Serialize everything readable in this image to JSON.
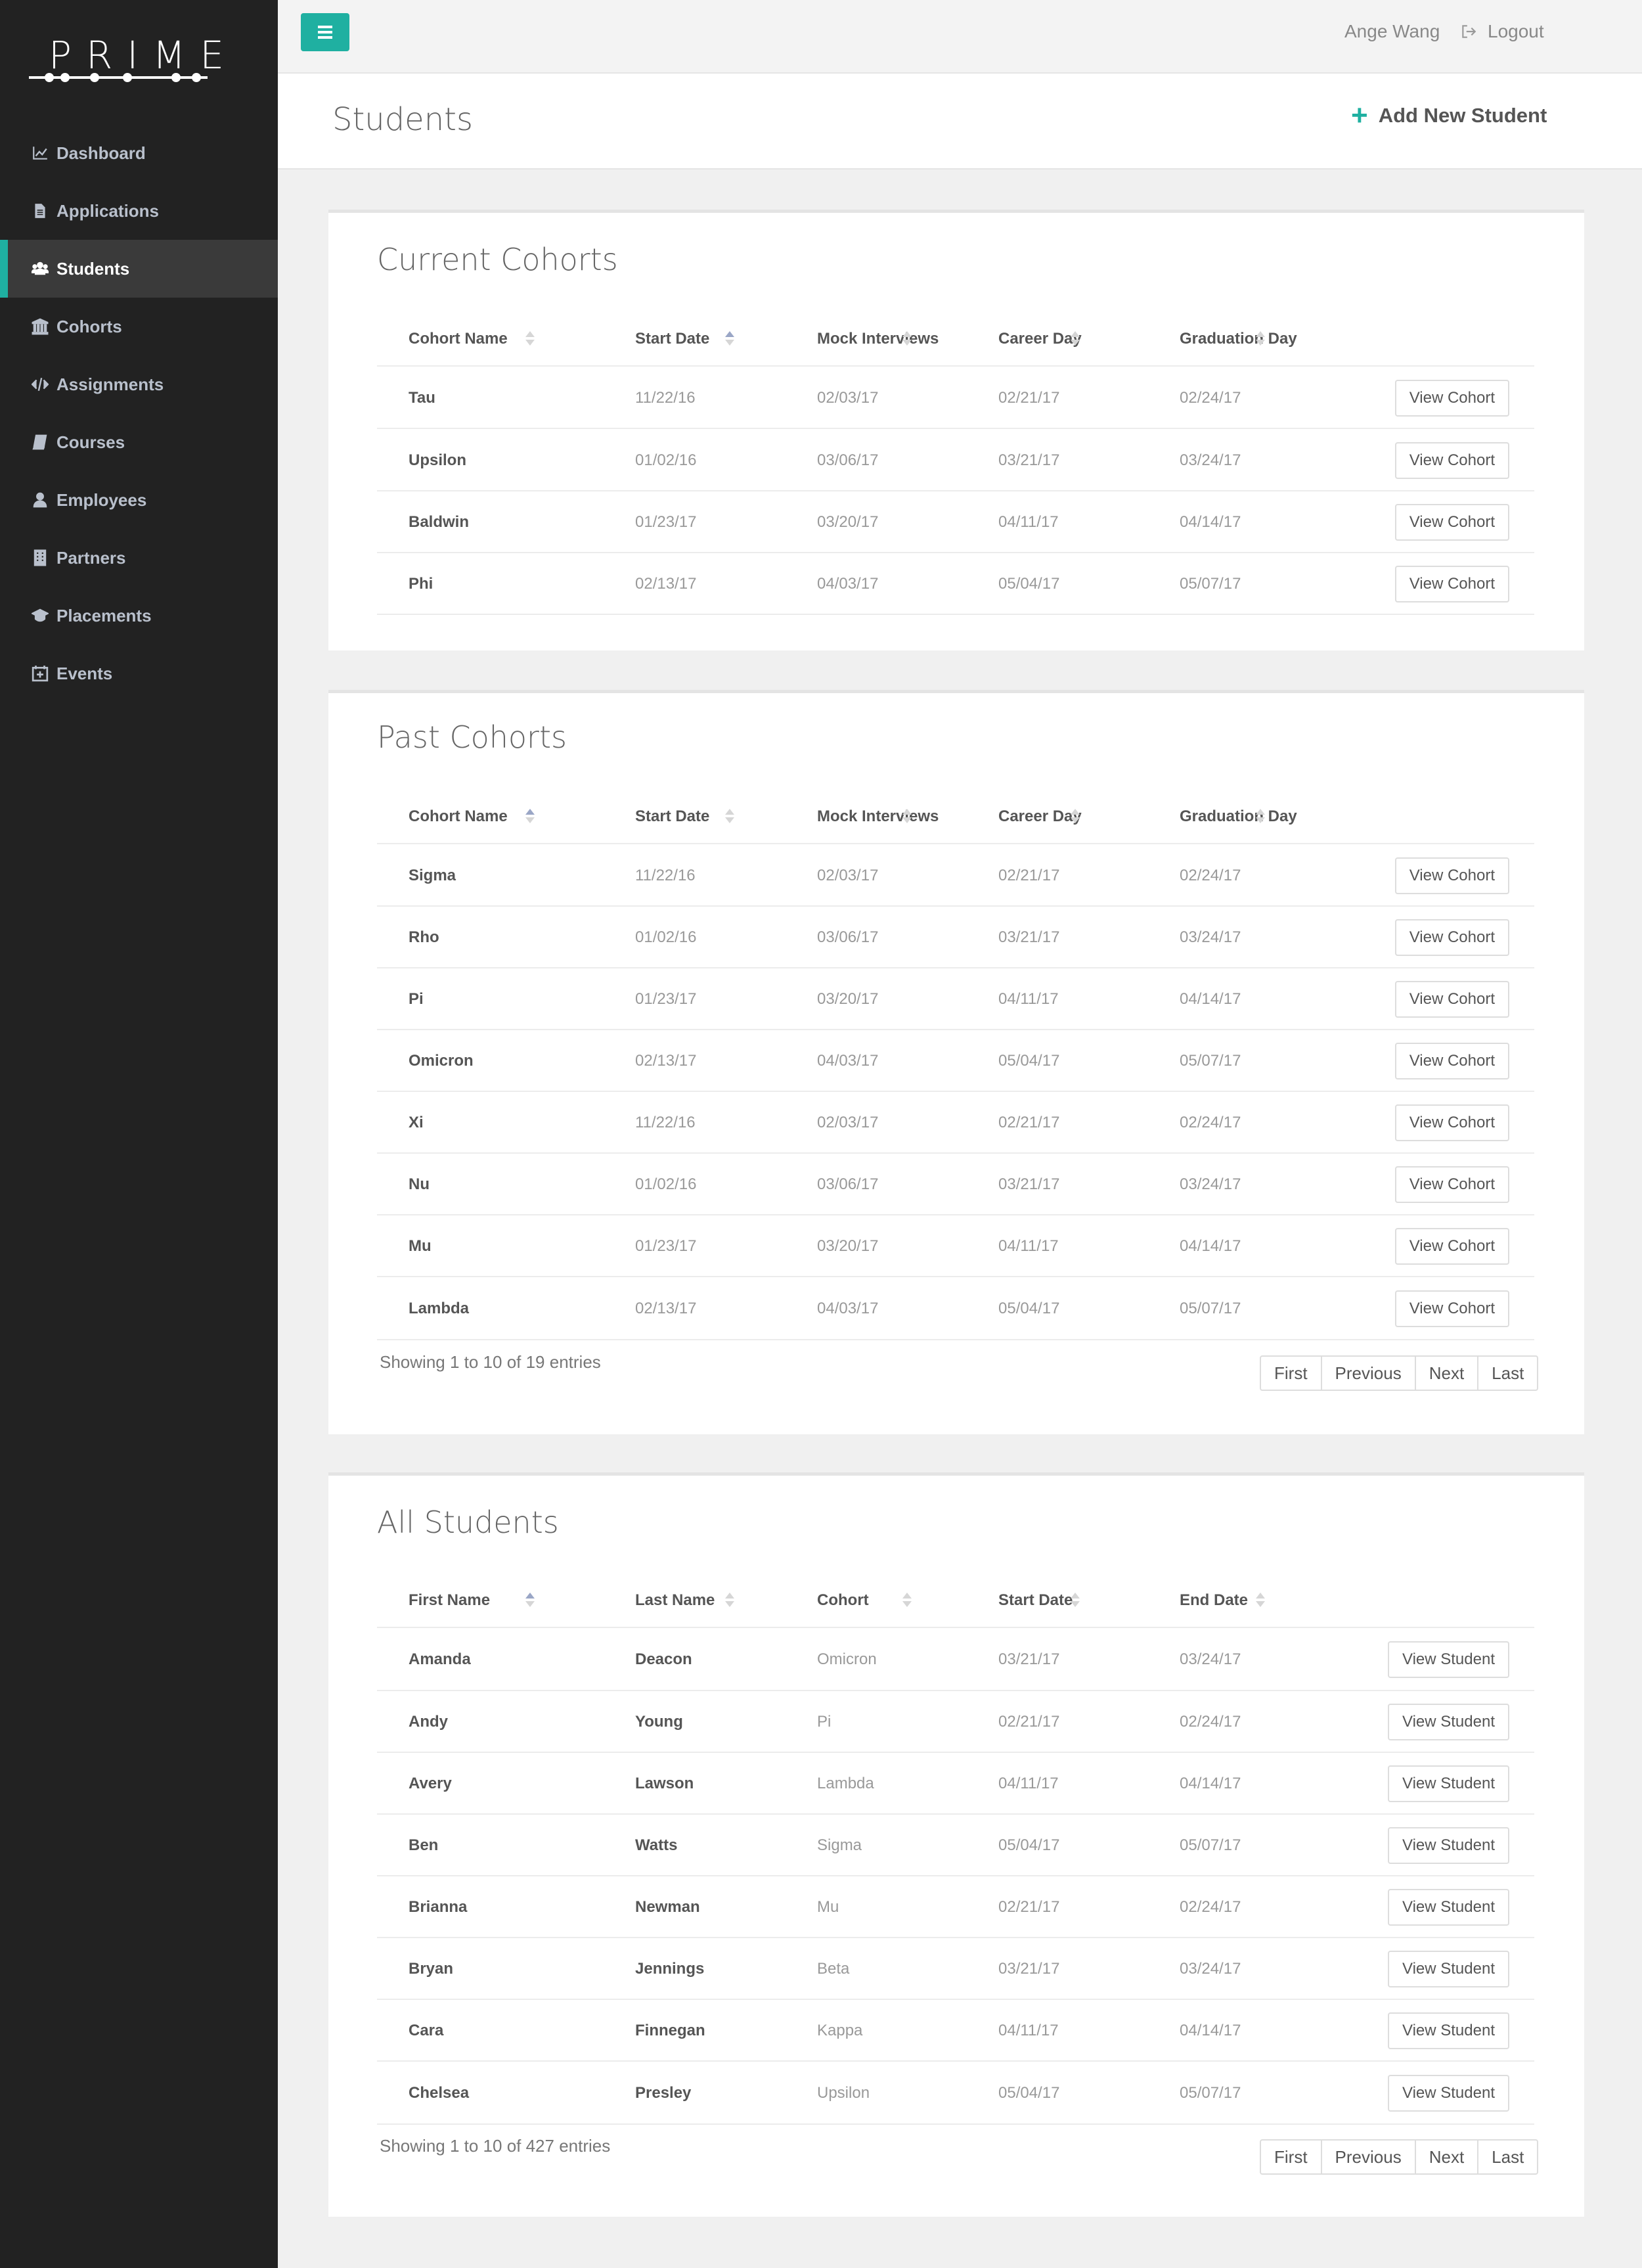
{
  "brand": {
    "logo_text": "PRIME"
  },
  "sidebar": {
    "items": [
      {
        "label": "Dashboard",
        "icon": "chart-line-icon"
      },
      {
        "label": "Applications",
        "icon": "file-icon"
      },
      {
        "label": "Students",
        "icon": "users-icon",
        "active": true
      },
      {
        "label": "Cohorts",
        "icon": "bank-icon"
      },
      {
        "label": "Assignments",
        "icon": "code-icon"
      },
      {
        "label": "Courses",
        "icon": "book-icon"
      },
      {
        "label": "Employees",
        "icon": "user-icon"
      },
      {
        "label": "Partners",
        "icon": "building-icon"
      },
      {
        "label": "Placements",
        "icon": "graduation-cap-icon"
      },
      {
        "label": "Events",
        "icon": "calendar-icon"
      }
    ]
  },
  "topbar": {
    "user_name": "Ange Wang",
    "logout_label": "Logout"
  },
  "header": {
    "title": "Students",
    "add_button": "Add New Student"
  },
  "current_cohorts": {
    "title": "Current Cohorts",
    "columns": [
      "Cohort Name",
      "Start Date",
      "Mock Interviews",
      "Career Day",
      "Graduation Day"
    ],
    "action_label": "View Cohort",
    "rows": [
      [
        "Tau",
        "11/22/16",
        "02/03/17",
        "02/21/17",
        "02/24/17"
      ],
      [
        "Upsilon",
        "01/02/16",
        "03/06/17",
        "03/21/17",
        "03/24/17"
      ],
      [
        "Baldwin",
        "01/23/17",
        "03/20/17",
        "04/11/17",
        "04/14/17"
      ],
      [
        "Phi",
        "02/13/17",
        "04/03/17",
        "05/04/17",
        "05/07/17"
      ]
    ]
  },
  "past_cohorts": {
    "title": "Past Cohorts",
    "columns": [
      "Cohort Name",
      "Start Date",
      "Mock Interviews",
      "Career Day",
      "Graduation Day"
    ],
    "action_label": "View Cohort",
    "rows": [
      [
        "Sigma",
        "11/22/16",
        "02/03/17",
        "02/21/17",
        "02/24/17"
      ],
      [
        "Rho",
        "01/02/16",
        "03/06/17",
        "03/21/17",
        "03/24/17"
      ],
      [
        "Pi",
        "01/23/17",
        "03/20/17",
        "04/11/17",
        "04/14/17"
      ],
      [
        "Omicron",
        "02/13/17",
        "04/03/17",
        "05/04/17",
        "05/07/17"
      ],
      [
        "Xi",
        "11/22/16",
        "02/03/17",
        "02/21/17",
        "02/24/17"
      ],
      [
        "Nu",
        "01/02/16",
        "03/06/17",
        "03/21/17",
        "03/24/17"
      ],
      [
        "Mu",
        "01/23/17",
        "03/20/17",
        "04/11/17",
        "04/14/17"
      ],
      [
        "Lambda",
        "02/13/17",
        "04/03/17",
        "05/04/17",
        "05/07/17"
      ]
    ],
    "showing": "Showing 1 to 10 of 19 entries",
    "pager": [
      "First",
      "Previous",
      "Next",
      "Last"
    ]
  },
  "all_students": {
    "title": "All Students",
    "columns": [
      "First Name",
      "Last Name",
      "Cohort",
      "Start Date",
      "End Date"
    ],
    "action_label": "View Student",
    "rows": [
      [
        "Amanda",
        "Deacon",
        "Omicron",
        "03/21/17",
        "03/24/17"
      ],
      [
        "Andy",
        "Young",
        "Pi",
        "02/21/17",
        "02/24/17"
      ],
      [
        "Avery",
        "Lawson",
        "Lambda",
        "04/11/17",
        "04/14/17"
      ],
      [
        "Ben",
        "Watts",
        "Sigma",
        "05/04/17",
        "05/07/17"
      ],
      [
        "Brianna",
        "Newman",
        "Mu",
        "02/21/17",
        "02/24/17"
      ],
      [
        "Bryan",
        "Jennings",
        "Beta",
        "03/21/17",
        "03/24/17"
      ],
      [
        "Cara",
        "Finnegan",
        "Kappa",
        "04/11/17",
        "04/14/17"
      ],
      [
        "Chelsea",
        "Presley",
        "Upsilon",
        "05/04/17",
        "05/07/17"
      ]
    ],
    "showing": "Showing 1 to 10 of 427 entries",
    "pager": [
      "First",
      "Previous",
      "Next",
      "Last"
    ]
  },
  "colors": {
    "accent": "#1fb0a1",
    "sidebar_bg": "#222222",
    "active_bg": "#3a3a3a"
  }
}
